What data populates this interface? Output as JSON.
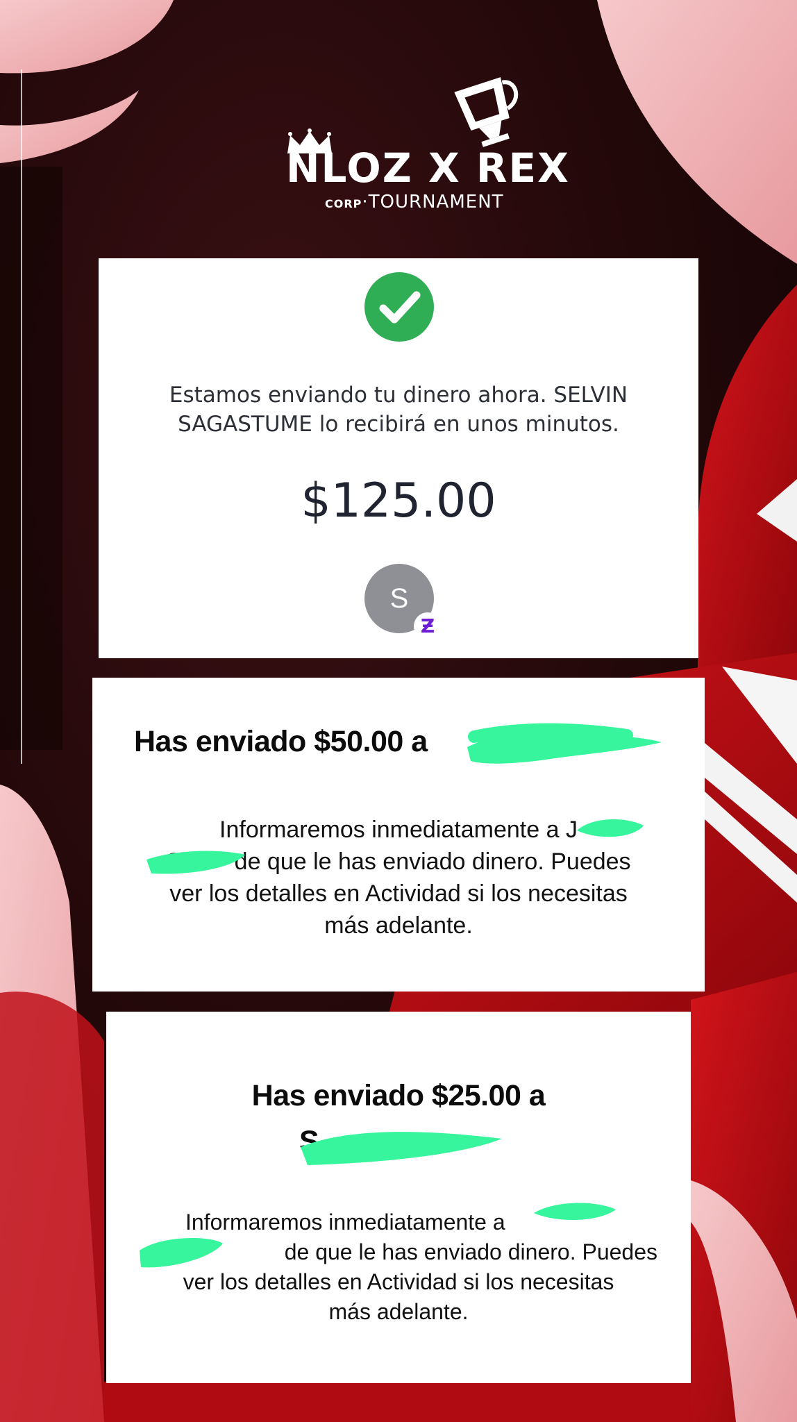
{
  "brand": {
    "logo_main": "NLOZ X REX",
    "logo_corp": "CORP",
    "logo_sub": "·TOURNAMENT"
  },
  "colors": {
    "accent_red": "#b5090f",
    "pink": "#f0b3b6",
    "success_green": "#2fae55",
    "zelle_purple": "#6d1ed4",
    "redaction_green": "#36f59c"
  },
  "card1": {
    "status_icon": "check-circle-icon",
    "message": "Estamos enviando tu dinero ahora. SELVIN SAGASTUME lo recibirá en unos minutos.",
    "amount": "$125.00",
    "avatar_initial": "S",
    "badge": "Ƶ"
  },
  "card2": {
    "title": "Has enviado $50.00 a",
    "body_line1": "Informaremos inmediatamente a J",
    "body_line2": "S        de que le has enviado dinero. Puedes",
    "body_line3": "ver los detalles en Actividad si los necesitas",
    "body_line4": "más adelante."
  },
  "card3": {
    "title_line1": "Has enviado $25.00 a",
    "title_line2": "S",
    "body_line1": "Informaremos inmediatamente a",
    "body_line2": "de que le has enviado dinero. Puedes",
    "body_line3": "ver los detalles en Actividad si los necesitas",
    "body_line4": "más adelante."
  }
}
